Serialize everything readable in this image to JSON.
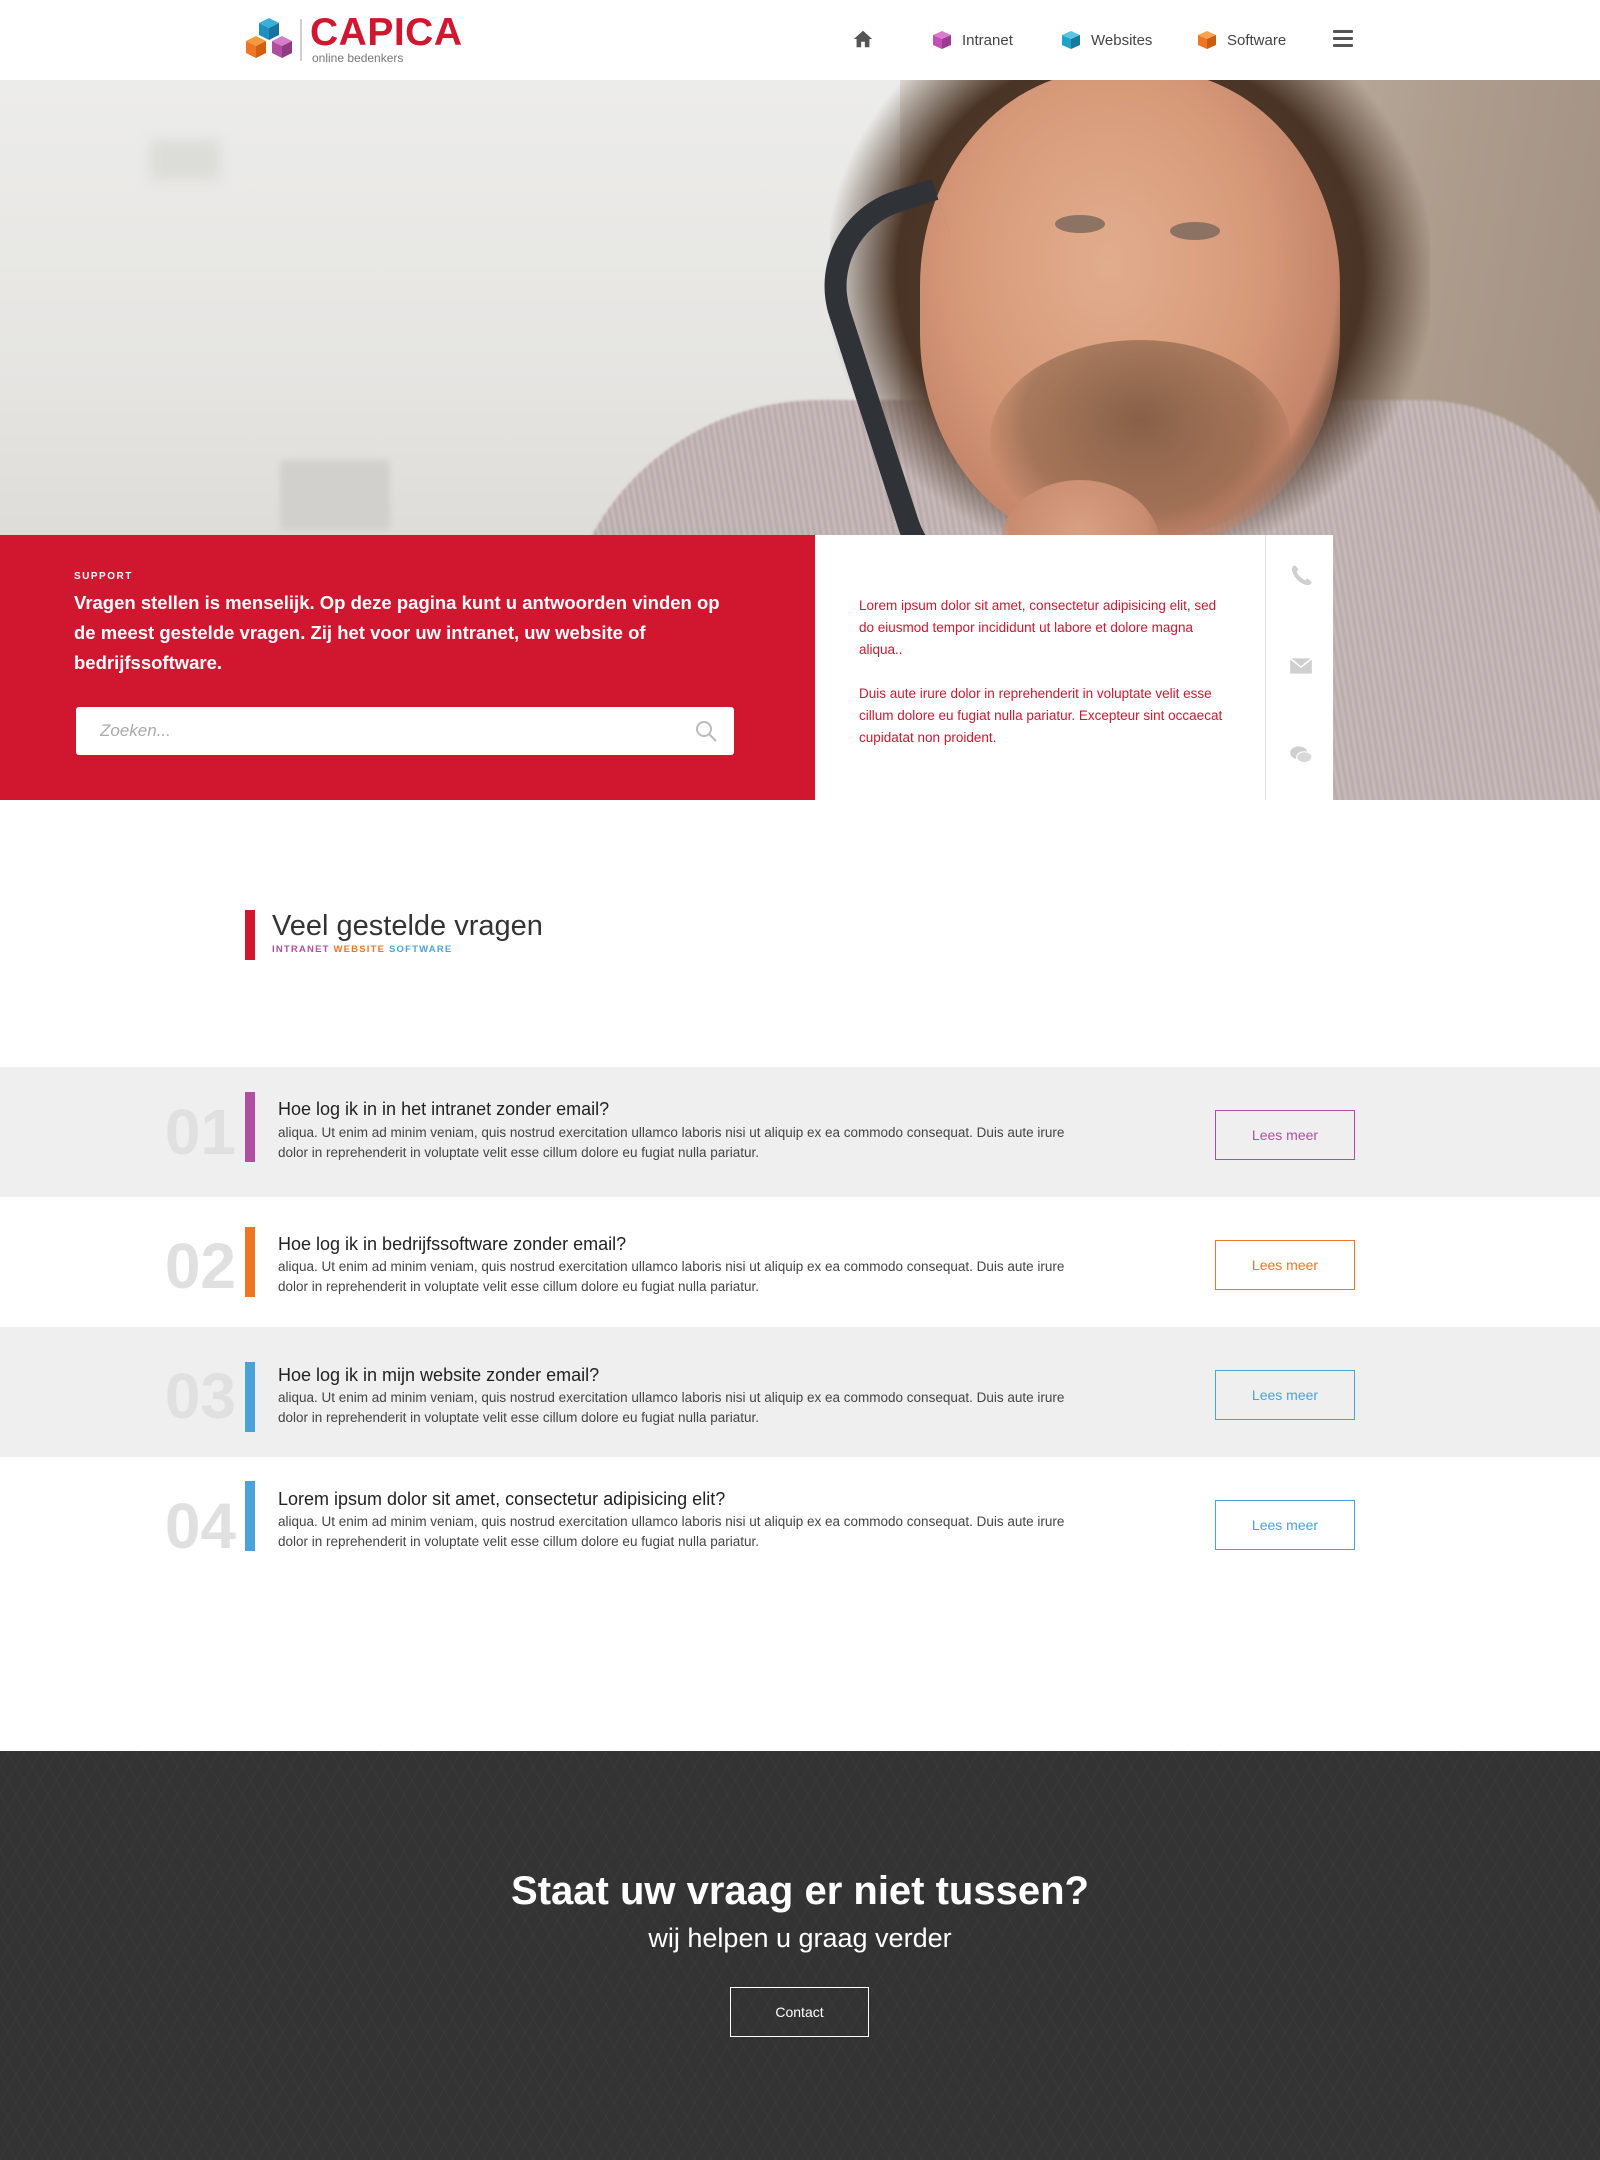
{
  "brand": {
    "name": "CAPICA",
    "tagline": "online bedenkers",
    "colors": {
      "red": "#d0172f",
      "purple": "#b04fa0",
      "orange": "#ee7622",
      "blue": "#4aa3d8",
      "teal": "#1fa3c9"
    }
  },
  "nav": {
    "home_icon": "home-icon",
    "items": [
      {
        "label": "Intranet",
        "icon": "cube-icon",
        "color": "#c24fb6"
      },
      {
        "label": "Websites",
        "icon": "cube-icon",
        "color": "#1fa3c9"
      },
      {
        "label": "Software",
        "icon": "cube-icon",
        "color": "#ee7622"
      }
    ],
    "menu_icon": "hamburger-icon"
  },
  "hero": {
    "eyebrow": "SUPPORT",
    "intro": "Vragen stellen is menselijk. Op deze pagina kunt u antwoorden vinden op de meest gestelde vragen. Zij het voor uw intranet, uw website of bedrijfssoftware.",
    "search": {
      "placeholder": "Zoeken...",
      "value": ""
    },
    "side_text": [
      "Lorem ipsum dolor sit amet, consectetur adipisicing elit, sed do eiusmod tempor incididunt ut labore et dolore magna aliqua..",
      "Duis aute irure dolor in reprehenderit in voluptate velit esse cillum dolore eu fugiat nulla pariatur. Excepteur sint occaecat cupidatat non proident."
    ],
    "contact_icons": [
      "phone-icon",
      "mail-icon",
      "chat-icon"
    ]
  },
  "faq": {
    "title": "Veel gestelde vragen",
    "categories": [
      {
        "label": "INTRANET",
        "color": "#b04fa0"
      },
      {
        "label": "WEBSITE",
        "color": "#ee7622"
      },
      {
        "label": "SOFTWARE",
        "color": "#4aa3d8"
      }
    ],
    "items": [
      {
        "number": "01",
        "question": "Hoe log ik in in het intranet zonder email?",
        "answer": "aliqua. Ut enim ad minim veniam, quis nostrud exercitation ullamco laboris nisi ut aliquip ex ea commodo consequat. Duis aute irure dolor in reprehenderit in voluptate velit esse cillum dolore eu fugiat nulla pariatur.",
        "button": "Lees meer",
        "color": "#b04fa0"
      },
      {
        "number": "02",
        "question": "Hoe log ik in bedrijfssoftware zonder email?",
        "answer": "aliqua. Ut enim ad minim veniam, quis nostrud exercitation ullamco laboris nisi ut aliquip ex ea commodo consequat. Duis aute irure dolor in reprehenderit in voluptate velit esse cillum dolore eu fugiat nulla pariatur.",
        "button": "Lees meer",
        "color": "#ee7622"
      },
      {
        "number": "03",
        "question": "Hoe log ik in mijn website zonder email?",
        "answer": "aliqua. Ut enim ad minim veniam, quis nostrud exercitation ullamco laboris nisi ut aliquip ex ea commodo consequat. Duis aute irure dolor in reprehenderit in voluptate velit esse cillum dolore eu fugiat nulla pariatur.",
        "button": "Lees meer",
        "color": "#4aa3d8"
      },
      {
        "number": "04",
        "question": "Lorem ipsum dolor sit amet, consectetur adipisicing elit?",
        "answer": "aliqua. Ut enim ad minim veniam, quis nostrud exercitation ullamco laboris nisi ut aliquip ex ea commodo consequat. Duis aute irure dolor in reprehenderit in voluptate velit esse cillum dolore eu fugiat nulla pariatur.",
        "button": "Lees meer",
        "color": "#4aa3d8"
      }
    ]
  },
  "cta": {
    "title": "Staat uw vraag er niet tussen?",
    "subtitle": "wij helpen u graag verder",
    "button": "Contact"
  }
}
